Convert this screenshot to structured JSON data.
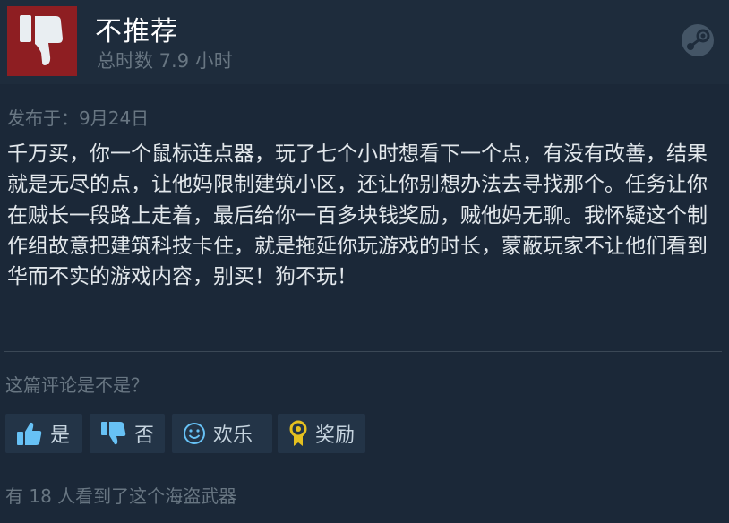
{
  "review": {
    "verdict": "不推荐",
    "hours": "总时数 7.9 小时",
    "posted": "发布于：9月24日",
    "text": "千万买，你一个鼠标连点器，玩了七个小时想看下一个点，有没有改善，结果就是无尽的点，让他妈限制建筑小区，还让你别想办法去寻找那个。任务让你在贼长一段路上走着，最后给你一百多块钱奖励，贼他妈无聊。我怀疑这个制作组故意把建筑科技卡住，就是拖延你玩游戏的时长，蒙蔽玩家不让他们看到华而不实的游戏内容，别买！狗不玩！"
  },
  "feedback": {
    "question": "这篇评论是不是？",
    "buttons": [
      {
        "label": "是",
        "icon": "thumbs-up-icon"
      },
      {
        "label": "否",
        "icon": "thumbs-down-icon"
      },
      {
        "label": "欢乐",
        "icon": "smiley-icon"
      },
      {
        "label": "奖励",
        "icon": "award-icon"
      }
    ],
    "seen": "有 18 人看到了这个海盗武器"
  },
  "colors": {
    "background": "#1b2838",
    "header": "#1e2c3c",
    "not_recommended": "#8e1e22",
    "muted_text": "#687682",
    "accent_blue": "#67c1f5",
    "award_gold": "#e5c01f"
  }
}
